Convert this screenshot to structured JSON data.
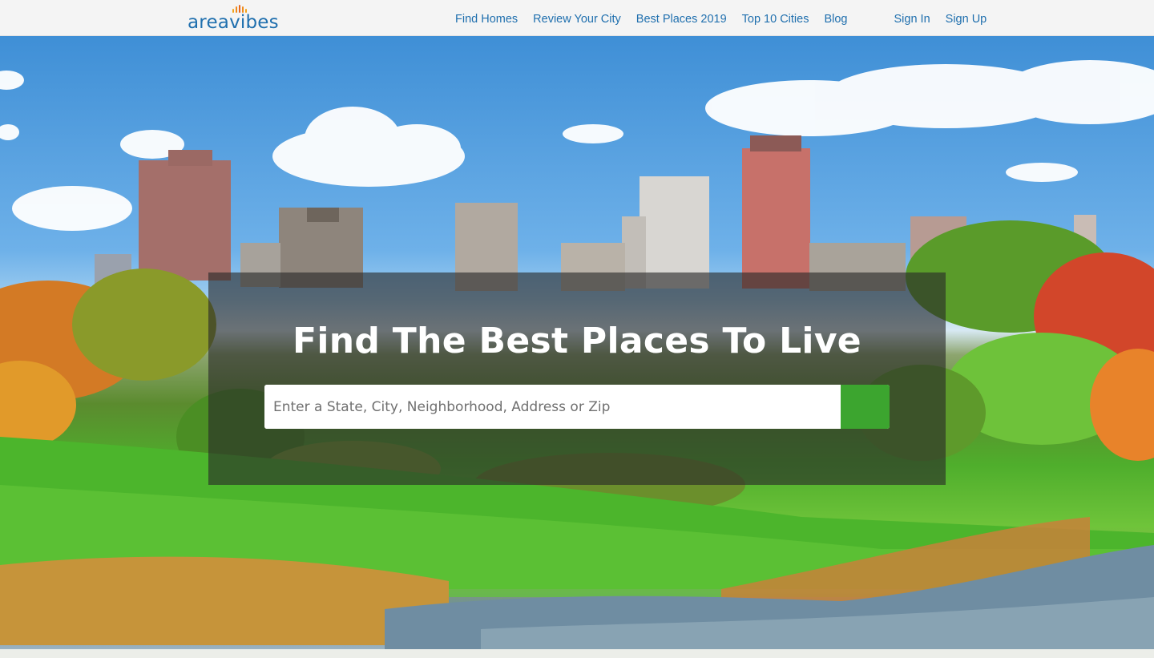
{
  "header": {
    "logo_text": "areavibes",
    "nav": {
      "find_homes": "Find Homes",
      "review_city": "Review Your City",
      "best_places": "Best Places 2019",
      "top10": "Top 10 Cities",
      "blog": "Blog",
      "sign_in": "Sign In",
      "sign_up": "Sign Up"
    }
  },
  "hero": {
    "headline": "Find The Best Places To Live",
    "search": {
      "placeholder": "Enter a State, City, Neighborhood, Address or Zip",
      "value": ""
    },
    "search_button_icon": "search-icon"
  },
  "colors": {
    "brand_blue": "#1f6fae",
    "search_green": "#3ca52f",
    "overlay": "rgba(40,40,40,0.62)"
  }
}
